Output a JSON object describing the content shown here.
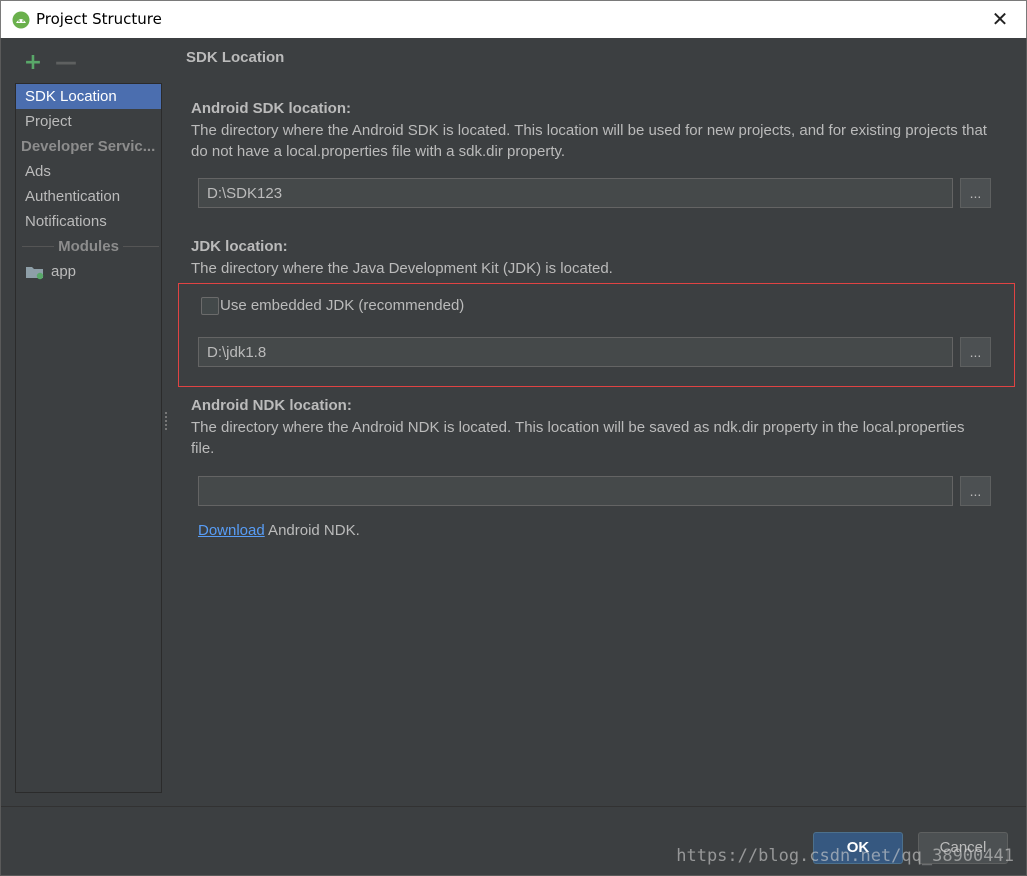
{
  "window": {
    "title": "Project Structure"
  },
  "toolbar": {
    "add": "+",
    "remove": "—"
  },
  "sidebar": {
    "items": [
      {
        "label": "SDK Location"
      },
      {
        "label": "Project"
      }
    ],
    "developer_services_header": "Developer Servic...",
    "services": [
      {
        "label": "Ads"
      },
      {
        "label": "Authentication"
      },
      {
        "label": "Notifications"
      }
    ],
    "modules_header": "Modules",
    "modules": [
      {
        "label": "app"
      }
    ]
  },
  "content": {
    "section_title": "SDK Location",
    "android_sdk": {
      "label": "Android SDK location:",
      "description": "The directory where the Android SDK is located. This location will be used for new projects, and for existing projects that do not have a local.properties file with a sdk.dir property.",
      "value": "D:\\SDK123",
      "browse": "..."
    },
    "jdk": {
      "label": "JDK location:",
      "description": "The directory where the Java Development Kit (JDK) is located.",
      "embedded_label": "Use embedded JDK (recommended)",
      "embedded_checked": false,
      "value": "D:\\jdk1.8",
      "browse": "..."
    },
    "ndk": {
      "label": "Android NDK location:",
      "description": "The directory where the Android NDK is located. This location will be saved as ndk.dir property in the local.properties file.",
      "value": "",
      "browse": "...",
      "download_link": "Download",
      "download_suffix": " Android NDK."
    }
  },
  "buttons": {
    "ok": "OK",
    "cancel": "Cancel"
  },
  "watermark": "https://blog.csdn.net/qq_38900441",
  "colors": {
    "selection": "#4b6eaf",
    "highlight_border": "#e04343",
    "link": "#589df6",
    "add_icon": "#59a869",
    "ok_button": "#365880"
  }
}
